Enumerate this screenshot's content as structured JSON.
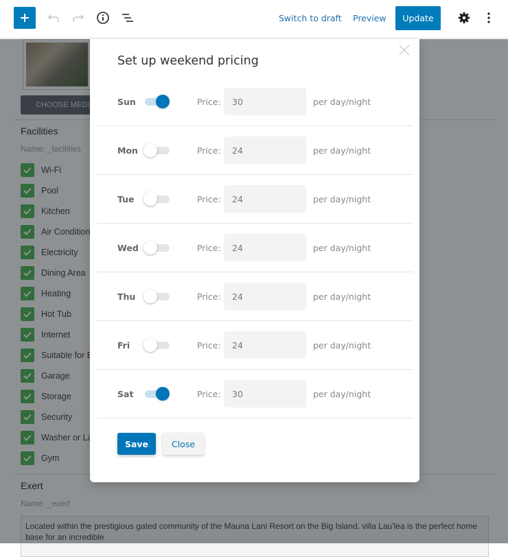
{
  "toolbar": {
    "add_icon": "plus-icon",
    "undo_icon": "undo-icon",
    "redo_icon": "redo-icon",
    "info_icon": "info-icon",
    "outline_icon": "list-outline-icon",
    "switch_to_draft": "Switch to draft",
    "preview": "Preview",
    "update": "Update",
    "settings_icon": "gear-icon",
    "more_icon": "vertical-ellipsis-icon"
  },
  "page": {
    "choose_media": "CHOOSE MEDIA",
    "facilities": {
      "title": "Facilities",
      "name": "Name: _facilities",
      "items": [
        {
          "label": "Wi-Fi",
          "checked": true
        },
        {
          "label": "Pool",
          "checked": true
        },
        {
          "label": "Kitchen",
          "checked": true
        },
        {
          "label": "Air Condition",
          "checked": true
        },
        {
          "label": "Electricity",
          "checked": true
        },
        {
          "label": "Dining Area",
          "checked": true
        },
        {
          "label": "Heating",
          "checked": true
        },
        {
          "label": "Hot Tub",
          "checked": true
        },
        {
          "label": "Internet",
          "checked": true
        },
        {
          "label": "Suitable for E",
          "checked": true
        },
        {
          "label": "Garage",
          "checked": true
        },
        {
          "label": "Storage",
          "checked": true
        },
        {
          "label": "Security",
          "checked": true
        },
        {
          "label": "Washer or La",
          "checked": true
        },
        {
          "label": "Gym",
          "checked": true
        }
      ]
    },
    "excerpt": {
      "title": "Exert",
      "name": "Name: _exert",
      "text": "Located within the prestigious gated community of the Mauna Lani Resort on the Big Island, villa Lau'lea is the perfect home base for an incredible"
    }
  },
  "modal": {
    "title": "Set up weekend pricing",
    "close_icon": "close-icon",
    "price_label": "Price:",
    "unit_label": "per day/night",
    "days": [
      {
        "day": "Sun",
        "enabled": true,
        "price": "30"
      },
      {
        "day": "Mon",
        "enabled": false,
        "price": "24"
      },
      {
        "day": "Tue",
        "enabled": false,
        "price": "24"
      },
      {
        "day": "Wed",
        "enabled": false,
        "price": "24"
      },
      {
        "day": "Thu",
        "enabled": false,
        "price": "24"
      },
      {
        "day": "Fri",
        "enabled": false,
        "price": "24"
      },
      {
        "day": "Sat",
        "enabled": true,
        "price": "30"
      }
    ],
    "save": "Save",
    "close": "Close"
  },
  "colors": {
    "accent": "#007cba",
    "toggle_on": "#0075b8",
    "checkbox": "#46b450"
  }
}
